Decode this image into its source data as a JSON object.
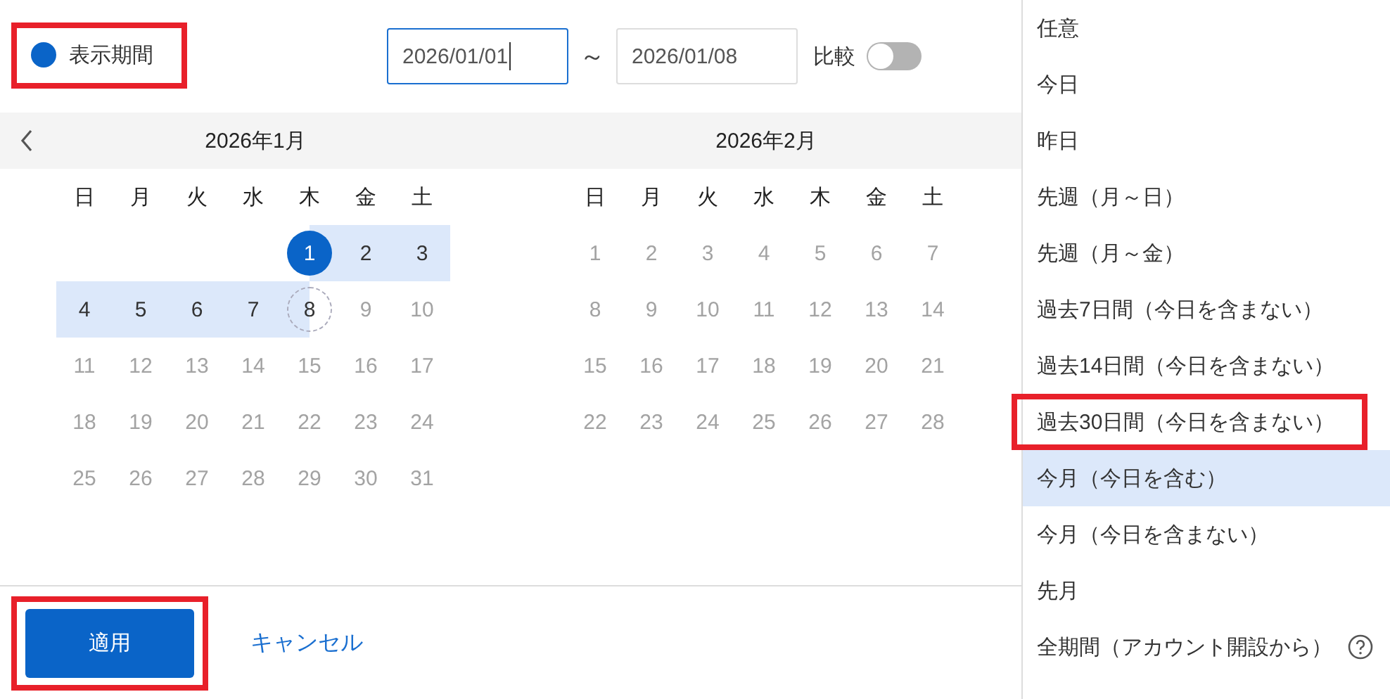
{
  "legend": {
    "label": "表示期間",
    "color": "#0a64c8",
    "highlighted": true
  },
  "range": {
    "start": {
      "value": "2026/01/01",
      "focused": true
    },
    "separator": "～",
    "end": {
      "value": "2026/01/08",
      "focused": false
    }
  },
  "compare": {
    "label": "比較",
    "on": false
  },
  "months": [
    {
      "title": "2026年1月",
      "weekdays": [
        "日",
        "月",
        "火",
        "水",
        "木",
        "金",
        "土"
      ],
      "weeks": [
        [
          {
            "label": "1",
            "kind": "start"
          },
          {
            "label": "2",
            "kind": "in-range"
          },
          {
            "label": "3",
            "kind": "in-range"
          }
        ],
        [
          {
            "label": "4",
            "kind": "in-range"
          },
          {
            "label": "5",
            "kind": "in-range"
          },
          {
            "label": "6",
            "kind": "in-range"
          },
          {
            "label": "7",
            "kind": "in-range"
          },
          {
            "label": "8",
            "kind": "end"
          },
          {
            "label": "9",
            "kind": "disabled"
          },
          {
            "label": "10",
            "kind": "disabled"
          }
        ],
        [
          {
            "label": "11",
            "kind": "disabled"
          },
          {
            "label": "12",
            "kind": "disabled"
          },
          {
            "label": "13",
            "kind": "disabled"
          },
          {
            "label": "14",
            "kind": "disabled"
          },
          {
            "label": "15",
            "kind": "disabled"
          },
          {
            "label": "16",
            "kind": "disabled"
          },
          {
            "label": "17",
            "kind": "disabled"
          }
        ],
        [
          {
            "label": "18",
            "kind": "disabled"
          },
          {
            "label": "19",
            "kind": "disabled"
          },
          {
            "label": "20",
            "kind": "disabled"
          },
          {
            "label": "21",
            "kind": "disabled"
          },
          {
            "label": "22",
            "kind": "disabled"
          },
          {
            "label": "23",
            "kind": "disabled"
          },
          {
            "label": "24",
            "kind": "disabled"
          }
        ],
        [
          {
            "label": "25",
            "kind": "disabled"
          },
          {
            "label": "26",
            "kind": "disabled"
          },
          {
            "label": "27",
            "kind": "disabled"
          },
          {
            "label": "28",
            "kind": "disabled"
          },
          {
            "label": "29",
            "kind": "disabled"
          },
          {
            "label": "30",
            "kind": "disabled"
          },
          {
            "label": "31",
            "kind": "disabled"
          }
        ]
      ]
    },
    {
      "title": "2026年2月",
      "weekdays": [
        "日",
        "月",
        "火",
        "水",
        "木",
        "金",
        "土"
      ],
      "weeks": [
        [
          {
            "label": "1",
            "kind": "disabled"
          },
          {
            "label": "2",
            "kind": "disabled"
          },
          {
            "label": "3",
            "kind": "disabled"
          },
          {
            "label": "4",
            "kind": "disabled"
          },
          {
            "label": "5",
            "kind": "disabled"
          },
          {
            "label": "6",
            "kind": "disabled"
          },
          {
            "label": "7",
            "kind": "disabled"
          }
        ],
        [
          {
            "label": "8",
            "kind": "disabled"
          },
          {
            "label": "9",
            "kind": "disabled"
          },
          {
            "label": "10",
            "kind": "disabled"
          },
          {
            "label": "11",
            "kind": "disabled"
          },
          {
            "label": "12",
            "kind": "disabled"
          },
          {
            "label": "13",
            "kind": "disabled"
          },
          {
            "label": "14",
            "kind": "disabled"
          }
        ],
        [
          {
            "label": "15",
            "kind": "disabled"
          },
          {
            "label": "16",
            "kind": "disabled"
          },
          {
            "label": "17",
            "kind": "disabled"
          },
          {
            "label": "18",
            "kind": "disabled"
          },
          {
            "label": "19",
            "kind": "disabled"
          },
          {
            "label": "20",
            "kind": "disabled"
          },
          {
            "label": "21",
            "kind": "disabled"
          }
        ],
        [
          {
            "label": "22",
            "kind": "disabled"
          },
          {
            "label": "23",
            "kind": "disabled"
          },
          {
            "label": "24",
            "kind": "disabled"
          },
          {
            "label": "25",
            "kind": "disabled"
          },
          {
            "label": "26",
            "kind": "disabled"
          },
          {
            "label": "27",
            "kind": "disabled"
          },
          {
            "label": "28",
            "kind": "disabled"
          }
        ]
      ]
    }
  ],
  "footer": {
    "apply": {
      "label": "適用",
      "highlighted": true
    },
    "cancel": "キャンセル"
  },
  "presets": [
    {
      "label": "任意",
      "selected": false,
      "highlighted": false,
      "help": false
    },
    {
      "label": "今日",
      "selected": false,
      "highlighted": false,
      "help": false
    },
    {
      "label": "昨日",
      "selected": false,
      "highlighted": false,
      "help": false
    },
    {
      "label": "先週（月～日）",
      "selected": false,
      "highlighted": false,
      "help": false
    },
    {
      "label": "先週（月～金）",
      "selected": false,
      "highlighted": false,
      "help": false
    },
    {
      "label": "過去7日間（今日を含まない）",
      "selected": false,
      "highlighted": false,
      "help": false
    },
    {
      "label": "過去14日間（今日を含まない）",
      "selected": false,
      "highlighted": false,
      "help": false
    },
    {
      "label": "過去30日間（今日を含まない）",
      "selected": false,
      "highlighted": true,
      "help": false
    },
    {
      "label": "今月（今日を含む）",
      "selected": true,
      "highlighted": false,
      "help": false
    },
    {
      "label": "今月（今日を含まない）",
      "selected": false,
      "highlighted": false,
      "help": false
    },
    {
      "label": "先月",
      "selected": false,
      "highlighted": false,
      "help": false
    },
    {
      "label": "全期間（アカウント開設から）",
      "selected": false,
      "highlighted": false,
      "help": true
    }
  ]
}
